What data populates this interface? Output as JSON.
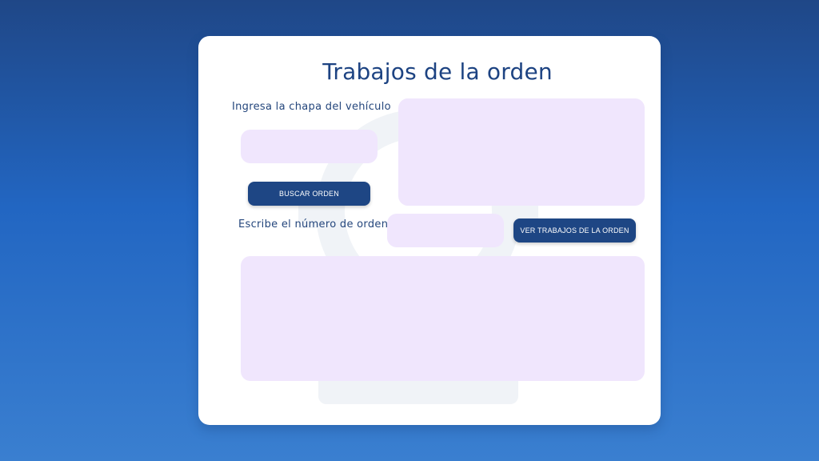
{
  "page": {
    "title": "Trabajos de la orden"
  },
  "plate_search": {
    "label": "Ingresa la chapa del vehículo",
    "input_value": "",
    "button_label": "BUSCAR ORDEN"
  },
  "order_search": {
    "label": "Escribe el número de orden",
    "input_value": "",
    "button_label": "VER TRABAJOS DE LA ORDEN"
  },
  "colors": {
    "background_top": "#1f4787",
    "background_bottom": "#3a7fd0",
    "accent": "#1e4684",
    "field": "#f0e6fd"
  },
  "icons": {
    "watermark": "gear-car-watermark-icon"
  }
}
